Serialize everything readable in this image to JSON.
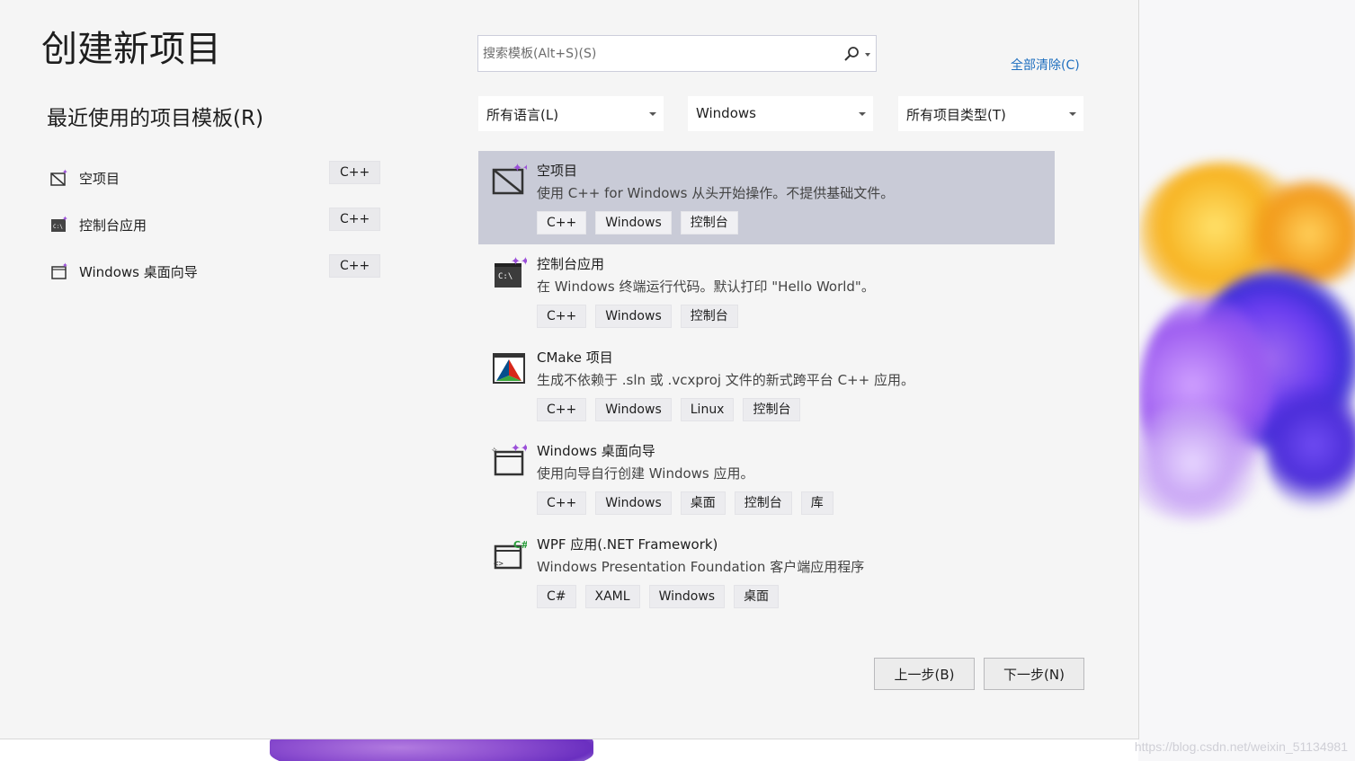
{
  "dialog": {
    "title": "创建新项目",
    "recent_heading": "最近使用的项目模板(R)"
  },
  "recent": [
    {
      "label": "空项目",
      "lang": "C++",
      "icon": "empty-project-icon"
    },
    {
      "label": "控制台应用",
      "lang": "C++",
      "icon": "console-app-icon"
    },
    {
      "label": "Windows 桌面向导",
      "lang": "C++",
      "icon": "desktop-wizard-icon"
    }
  ],
  "search": {
    "placeholder": "搜索模板(Alt+S)(S)",
    "icon": "search-icon"
  },
  "clear_all": "全部清除(C)",
  "filters": {
    "language": "所有语言(L)",
    "platform": "Windows",
    "project_type": "所有项目类型(T)"
  },
  "templates": [
    {
      "name": "空项目",
      "desc": "使用 C++ for Windows 从头开始操作。不提供基础文件。",
      "tags": [
        "C++",
        "Windows",
        "控制台"
      ],
      "selected": true
    },
    {
      "name": "控制台应用",
      "desc": "在 Windows 终端运行代码。默认打印 \"Hello World\"。",
      "tags": [
        "C++",
        "Windows",
        "控制台"
      ]
    },
    {
      "name": "CMake 项目",
      "desc": "生成不依赖于 .sln 或 .vcxproj 文件的新式跨平台 C++ 应用。",
      "tags": [
        "C++",
        "Windows",
        "Linux",
        "控制台"
      ]
    },
    {
      "name": "Windows 桌面向导",
      "desc": "使用向导自行创建 Windows 应用。",
      "tags": [
        "C++",
        "Windows",
        "桌面",
        "控制台",
        "库"
      ]
    },
    {
      "name": "WPF 应用(.NET Framework)",
      "desc": "Windows Presentation Foundation 客户端应用程序",
      "tags": [
        "C#",
        "XAML",
        "Windows",
        "桌面"
      ]
    }
  ],
  "buttons": {
    "back": "上一步(B)",
    "next": "下一步(N)"
  },
  "watermark": "https://blog.csdn.net/weixin_51134981",
  "colors": {
    "accent": "#1f6fbf",
    "selected_bg": "#c9cbd7",
    "dialog_bg": "#f5f5f5"
  }
}
